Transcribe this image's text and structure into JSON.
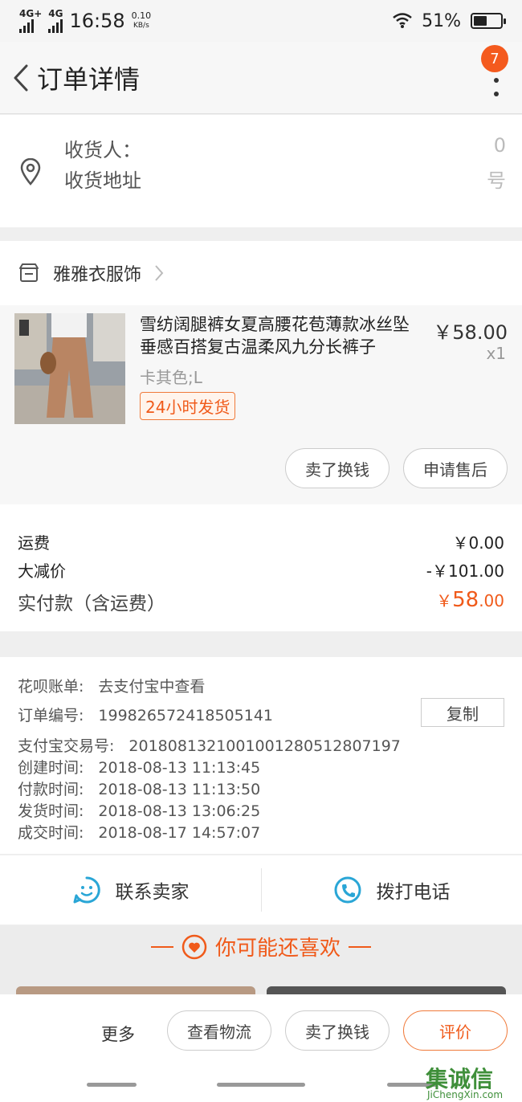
{
  "status_bar": {
    "signal1": "4G+",
    "signal2": "4G",
    "time": "16:58",
    "net_speed_value": "0.10",
    "net_speed_unit": "KB/s",
    "battery": "51%",
    "battery_level": 0.51
  },
  "nav": {
    "title": "订单详情",
    "badge_count": "7"
  },
  "address": {
    "receiver_label": "收货人：",
    "address_label": "收货地址",
    "receiver_tail": "0",
    "address_tail": "号"
  },
  "shop": {
    "name": "雅雅衣服饰"
  },
  "product": {
    "title": "雪纺阔腿裤女夏高腰花苞薄款冰丝坠垂感百搭复古温柔风九分长裤子",
    "price": "￥58.00",
    "qty": "x1",
    "sku": "卡其色;L",
    "tag": "24小时发货",
    "btn_sell": "卖了换钱",
    "btn_aftersale": "申请售后"
  },
  "summary": {
    "shipping_label": "运费",
    "shipping_value": "￥0.00",
    "discount_label": "大减价",
    "discount_value": "-￥101.00",
    "total_label": "实付款（含运费）",
    "total_currency": "￥",
    "total_int": "58",
    "total_dec": ".00"
  },
  "order_info": {
    "huabei_label": "花呗账单:",
    "huabei_value": "去支付宝中查看",
    "order_no_label": "订单编号:",
    "order_no_value": "199826572418505141",
    "copy_label": "复制",
    "alipay_label": "支付宝交易号:",
    "alipay_value": "2018081321001001280512807197",
    "created_label": "创建时间:",
    "created_value": "2018-08-13 11:13:45",
    "paid_label": "付款时间:",
    "paid_value": "2018-08-13 11:13:50",
    "shipped_label": "发货时间:",
    "shipped_value": "2018-08-13 13:06:25",
    "closed_label": "成交时间:",
    "closed_value": "2018-08-17 14:57:07"
  },
  "contact": {
    "seller_label": "联系卖家",
    "phone_label": "拨打电话"
  },
  "recommend": {
    "title": "你可能还喜欢"
  },
  "bottom_bar": {
    "more": "更多",
    "logistics": "查看物流",
    "sell": "卖了换钱",
    "rate": "评价"
  },
  "watermark": {
    "text": "集诚信",
    "sub": "JiChengXin.com"
  },
  "colors": {
    "accent": "#f05a1a",
    "contact_icon": "#2aa6d6"
  }
}
